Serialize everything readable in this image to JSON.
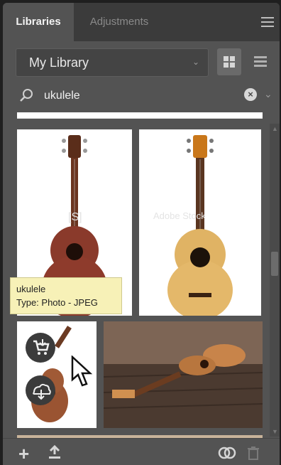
{
  "tabs": {
    "active": "Libraries",
    "inactive": "Adjustments"
  },
  "library": {
    "selected": "My Library"
  },
  "search": {
    "value": "ukulele"
  },
  "tooltip": {
    "title": "ukulele",
    "type_line": "Type: Photo - JPEG"
  },
  "watermark": "Adobe Stock",
  "colors": {
    "panel": "#535353",
    "tabbar": "#3b3b3b",
    "tooltip_bg": "#f7f1b7",
    "text": "#e8e8e8"
  },
  "icons": [
    "panel-menu-icon",
    "grid-view-icon",
    "list-view-icon",
    "search-icon",
    "clear-search-icon",
    "chevron-down-icon",
    "cart-icon",
    "cloud-download-icon",
    "cursor-icon",
    "add-icon",
    "upload-icon",
    "link-icon",
    "trash-icon"
  ]
}
